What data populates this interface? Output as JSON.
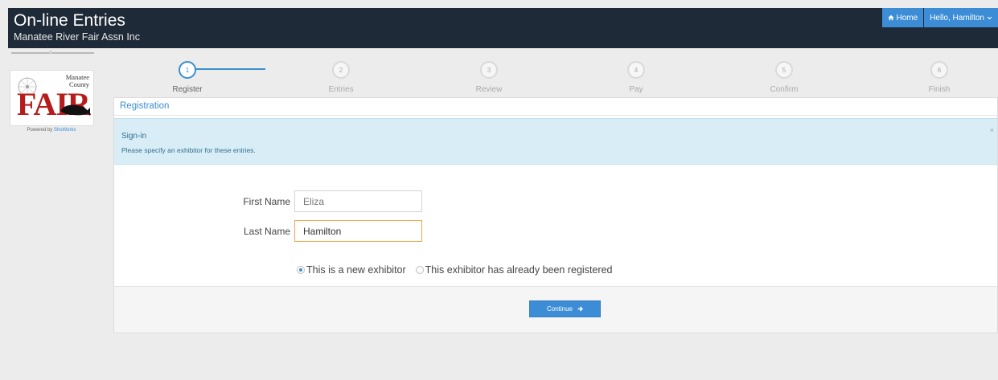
{
  "header": {
    "title": "On-line Entries",
    "subtitle": "Manatee River Fair Assn Inc",
    "nav": {
      "home_label": "Home",
      "user_label": "Hello, Hamilton"
    }
  },
  "sidebar": {
    "logo": {
      "county_line1": "Manatee",
      "county_line2": "County",
      "wordmark": "FAIR"
    },
    "powered_by_prefix": "Powered by",
    "powered_by_link": "ShoWorks"
  },
  "steps": [
    {
      "number": "1",
      "label": "Register",
      "active": true
    },
    {
      "number": "2",
      "label": "Entries",
      "active": false
    },
    {
      "number": "3",
      "label": "Review",
      "active": false
    },
    {
      "number": "4",
      "label": "Pay",
      "active": false
    },
    {
      "number": "5",
      "label": "Confirm",
      "active": false
    },
    {
      "number": "6",
      "label": "Finish",
      "active": false
    }
  ],
  "panel": {
    "heading": "Registration",
    "alert": {
      "title": "Sign-in",
      "text": "Please specify an exhibitor for these entries.",
      "close": "×"
    },
    "form": {
      "first_name_label": "First Name",
      "first_name_value": "Eliza",
      "last_name_label": "Last Name",
      "last_name_value": "Hamilton"
    },
    "radios": {
      "new_label": "This is a new exhibitor",
      "existing_label": "This exhibitor has already been registered",
      "selected": "new"
    },
    "continue_label": "Continue"
  },
  "colors": {
    "header_bg": "#1f2a38",
    "accent": "#3c8dd6",
    "alert_bg": "#d8edf6",
    "fair_red": "#b51c1c",
    "focus_border": "#f0a84a"
  }
}
